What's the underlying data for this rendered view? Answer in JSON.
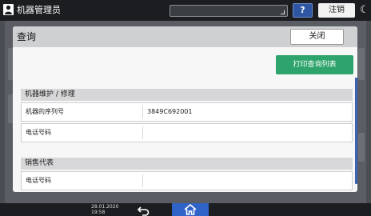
{
  "topbar": {
    "app_title": "机器管理员",
    "help_label": "?",
    "logout_label": "注销",
    "user_icon": "user-icon",
    "sleep_icon": "moon-icon"
  },
  "dialog": {
    "title": "查询",
    "close_label": "关闭",
    "print_label": "打印查询列表",
    "sections": [
      {
        "heading": "机器维护 / 修理",
        "rows": [
          {
            "label": "机器的序列号",
            "value": "3849C692001"
          },
          {
            "label": "电话号码",
            "value": ""
          }
        ]
      },
      {
        "heading": "销售代表",
        "rows": [
          {
            "label": "电话号码",
            "value": ""
          }
        ]
      }
    ]
  },
  "bottombar": {
    "date": "28.01.2020",
    "time": "19:58",
    "back_icon": "back-arrow-icon",
    "home_icon": "home-icon"
  },
  "colors": {
    "accent_green": "#2ea36b",
    "accent_blue": "#2f63c8",
    "topbar_bg": "#1b1d20"
  }
}
